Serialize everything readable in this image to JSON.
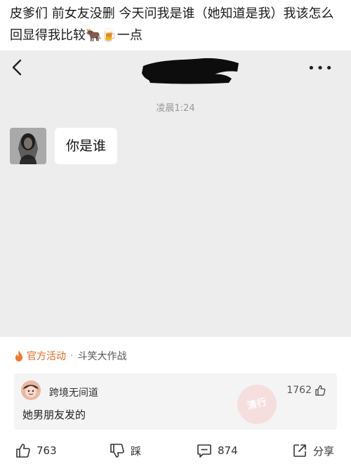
{
  "post": {
    "text": "皮爹们 前女友没删 今天问我是谁（她知道是我）我该怎么回显得我比较🐂🍺一点"
  },
  "chat": {
    "more_icon": "more-dots-icon",
    "timestamp": "凌晨1:24",
    "message": "你是谁"
  },
  "activity": {
    "label": "官方活动",
    "separator": "·",
    "title": "斗笑大作战"
  },
  "comment": {
    "user": "跨境无间道",
    "likes": "1762",
    "text": "她男朋友发的",
    "stamp_text": "清行"
  },
  "actions": {
    "like_count": "763",
    "dislike_label": "踩",
    "comment_count": "874",
    "share_label": "分享"
  },
  "colors": {
    "chat_bg": "#ededed",
    "accent_orange": "#e06a1e"
  }
}
